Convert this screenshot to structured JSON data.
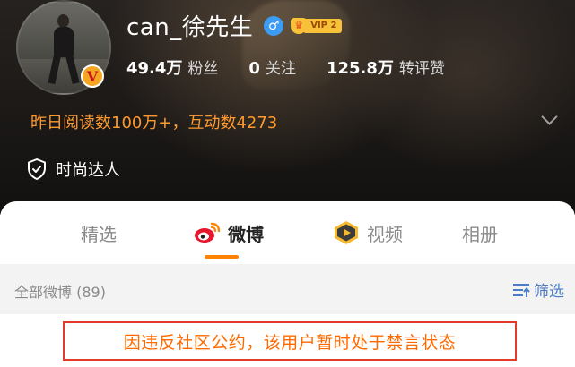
{
  "profile": {
    "username": "can_徐先生",
    "gender_icon": "male-symbol",
    "verified_badge_letter": "V",
    "vip_label": "VIP 2"
  },
  "stats": [
    {
      "value": "49.4万",
      "label": "粉丝"
    },
    {
      "value": "0",
      "label": "关注"
    },
    {
      "value": "125.8万",
      "label": "转评赞"
    }
  ],
  "read_info": "昨日阅读数100万+，互动数4273",
  "tag": "时尚达人",
  "tabs": [
    {
      "label": "精选"
    },
    {
      "label": "微博",
      "active": true
    },
    {
      "label": "视频"
    },
    {
      "label": "相册"
    }
  ],
  "filter": {
    "all_label": "全部微博 (89)",
    "filter_label": "筛选"
  },
  "notice": "因违反社区公约，该用户暂时处于禁言状态",
  "colors": {
    "accent_orange": "#ff8200",
    "read_info_orange": "#ff9a2e",
    "notice_border": "#e23b2c",
    "filter_blue": "#4a7cc7",
    "gender_blue": "#3d9bf2",
    "vip_gold": "#f7c23a"
  }
}
